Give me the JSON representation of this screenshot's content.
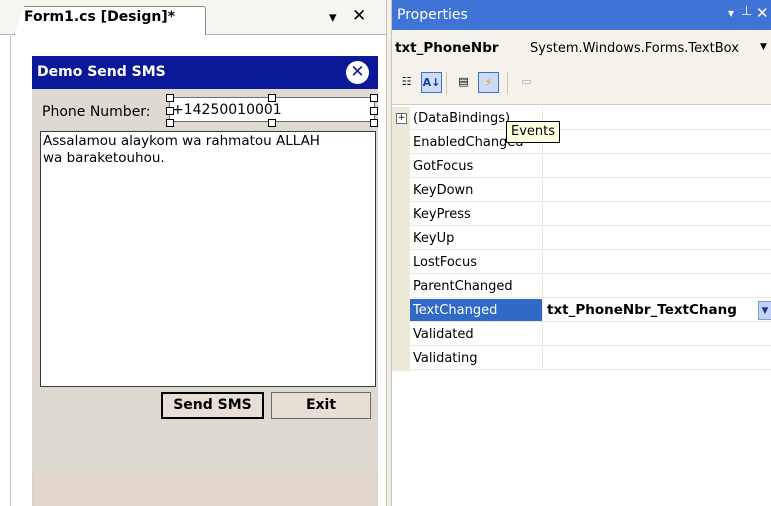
{
  "document_tab": {
    "label": "Form1.cs [Design]*",
    "menu_glyph": "▾",
    "close_glyph": "✕"
  },
  "form": {
    "title": "Demo Send SMS",
    "close_glyph": "✕",
    "phone_label": "Phone Number:",
    "phone_value": "+14250010001",
    "message": "Assalamou alaykom wa rahmatou ALLAH\nwa baraketouhou.",
    "send_button": "Send SMS",
    "exit_button": "Exit"
  },
  "properties": {
    "title": "Properties",
    "pin_glyph": "▾",
    "autohide_glyph": "⊥",
    "close_glyph": "✕",
    "object_name": "txt_PhoneNbr",
    "object_type": "System.Windows.Forms.TextBox",
    "toolbar": {
      "categorized": "☷",
      "alphabetical": "A↓",
      "properties": "▤",
      "events": "⚡",
      "property_pages": "▭"
    },
    "rows": [
      {
        "name": "(DataBindings)",
        "value": "",
        "expandable": true
      },
      {
        "name": "EnabledChanged",
        "value": ""
      },
      {
        "name": "GotFocus",
        "value": ""
      },
      {
        "name": "KeyDown",
        "value": ""
      },
      {
        "name": "KeyPress",
        "value": ""
      },
      {
        "name": "KeyUp",
        "value": ""
      },
      {
        "name": "LostFocus",
        "value": ""
      },
      {
        "name": "ParentChanged",
        "value": ""
      },
      {
        "name": "TextChanged",
        "value": "txt_PhoneNbr_TextChang",
        "selected": true
      },
      {
        "name": "Validated",
        "value": ""
      },
      {
        "name": "Validating",
        "value": ""
      }
    ],
    "tooltip": "Events",
    "expander_glyph": "+",
    "value_dropdown_glyph": "▼"
  },
  "colors": {
    "form_title_bar": "#0b1897",
    "properties_title_bar": "#3f73d6",
    "selection": "#3169c6",
    "tooltip_bg": "#ffffe1"
  }
}
